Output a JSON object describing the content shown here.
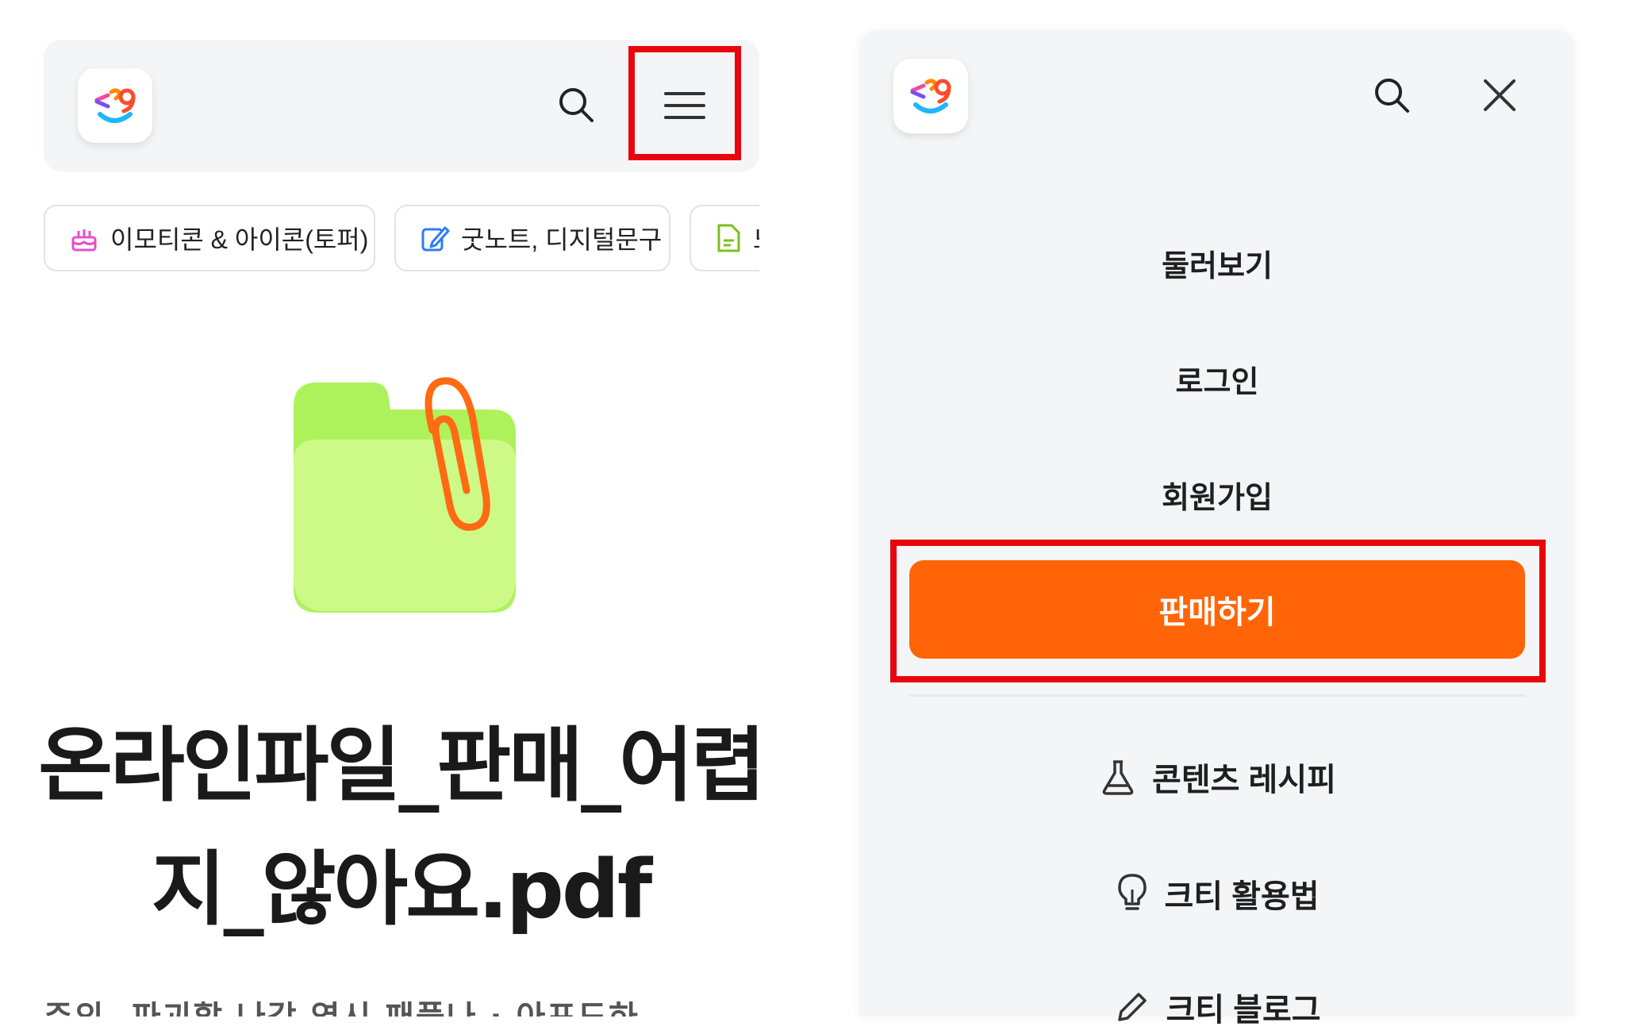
{
  "left": {
    "header": {
      "logo_icon": "app-logo-icon",
      "search_icon": "search-icon",
      "menu_icon": "hamburger-menu-icon"
    },
    "categories": [
      {
        "label": "이모티콘 & 아이콘(토퍼)",
        "icon": "cake-icon",
        "color": "#e64fc7"
      },
      {
        "label": "굿노트, 디지털문구",
        "icon": "edit-icon",
        "color": "#2f7cf6"
      },
      {
        "label": "노",
        "icon": "document-icon",
        "color": "#7ac11b"
      }
    ],
    "file_title": "온라인파일_판매_어렵지_않아요.pdf",
    "cut_text": "주의. 파괴할 나각 역시 패플나 · 아포도하"
  },
  "drawer": {
    "close_icon": "close-icon",
    "menu_items": [
      "둘러보기",
      "로그인",
      "회원가입"
    ],
    "sell_label": "판매하기",
    "sub_items": [
      {
        "label": "콘텐츠 레시피",
        "icon": "flask-icon"
      },
      {
        "label": "크티 활용법",
        "icon": "lightbulb-icon"
      },
      {
        "label": "크티 블로그",
        "icon": "pencil-icon"
      }
    ]
  },
  "colors": {
    "accent_orange": "#ff6508",
    "highlight_red": "#e8050e",
    "header_bg": "#f4f5f7"
  }
}
